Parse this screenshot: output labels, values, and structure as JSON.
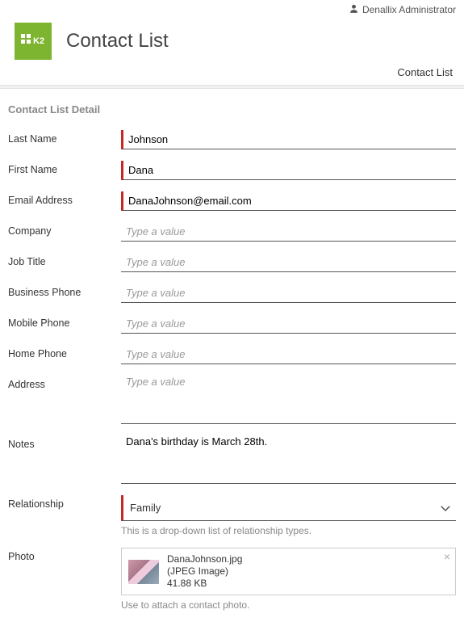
{
  "topbar": {
    "user": "Denallix Administrator"
  },
  "header": {
    "title": "Contact List"
  },
  "breadcrumb": {
    "text": "Contact List"
  },
  "section": {
    "title": "Contact List Detail"
  },
  "labels": {
    "lastName": "Last Name",
    "firstName": "First Name",
    "email": "Email Address",
    "company": "Company",
    "jobTitle": "Job Title",
    "businessPhone": "Business Phone",
    "mobilePhone": "Mobile Phone",
    "homePhone": "Home Phone",
    "address": "Address",
    "notes": "Notes",
    "relationship": "Relationship",
    "photo": "Photo"
  },
  "placeholders": {
    "generic": "Type a value"
  },
  "values": {
    "lastName": "Johnson",
    "firstName": "Dana",
    "email": "DanaJohnson@email.com",
    "company": "",
    "jobTitle": "",
    "businessPhone": "",
    "mobilePhone": "",
    "homePhone": "",
    "address": "",
    "notes": "Dana's birthday is March 28th.",
    "relationship": "Family"
  },
  "helpers": {
    "relationship": "This is a drop-down list of relationship types.",
    "photo": "Use to attach a contact photo."
  },
  "attachment": {
    "name": "DanaJohnson.jpg",
    "type": "(JPEG Image)",
    "size": "41.88 KB"
  }
}
